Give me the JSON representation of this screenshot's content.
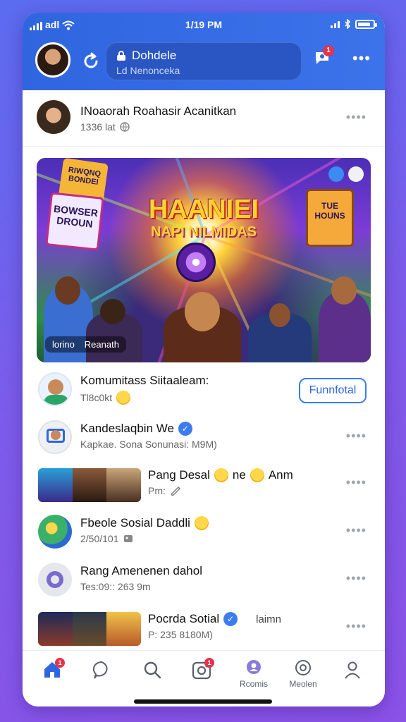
{
  "status": {
    "time": "1/19 PM",
    "carrier": "adl"
  },
  "header": {
    "search_title": "Dohdele",
    "search_subtitle": "Ld Nenonceka",
    "notif_count": "1"
  },
  "post": {
    "author": "INoaorah Roahasir Acanitkan",
    "meta": "1336 lat",
    "banner_title": "HAANIEI",
    "banner_subtitle": "NAPI NILMIDAS",
    "sign1": "RIWQNQ BONDEI",
    "sign2": "BOWSER DROUN",
    "sign3": "TUE HOUNS",
    "caption_left": "lorino",
    "caption_right": "Reanath"
  },
  "rows": [
    {
      "title": "Komumitass Siitaaleam:",
      "sub": "Tl8c0kt",
      "action": "Funnfotal"
    },
    {
      "title": "Kandeslaqbin We",
      "sub": "Kapkae. Sona Sonunasi: M9M)"
    },
    {
      "title": "Pang Desal",
      "title2": "ne",
      "title3": "Anm",
      "sub": "Pm:"
    },
    {
      "title": "Fbeole Sosial Daddli",
      "sub": "2/50/101"
    },
    {
      "title": "Rang Amenenen dahol",
      "sub": "Tes:09:: 263 9m"
    },
    {
      "title": "Pocrda Sotial",
      "extra": "laimn",
      "sub": "P:  235 8180M)"
    }
  ],
  "nav": {
    "home_badge": "1",
    "camera_badge": "1",
    "label_5": "Rcomis",
    "label_6": "Meolen"
  }
}
